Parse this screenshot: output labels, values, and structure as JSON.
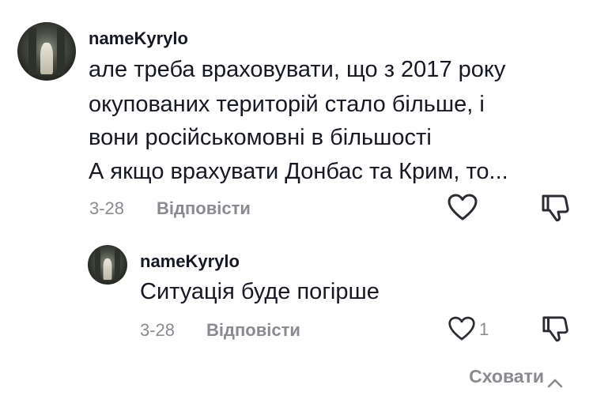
{
  "comment": {
    "username": "nameKyrylo",
    "lines": [
      "але треба враховувати, що з 2017 року",
      "окупованих територій стало більше, і",
      "вони російськомовні в більшості",
      "А якщо врахувати Донбас та Крим, то..."
    ],
    "date": "3-28",
    "reply_label": "Відповісти"
  },
  "reply": {
    "username": "nameKyrylo",
    "text": "Ситуація буде погірше",
    "date": "3-28",
    "reply_label": "Відповісти",
    "like_count": "1"
  },
  "hide_label": "Сховати",
  "icons": {
    "like": "heart-outline-icon",
    "dislike": "thumbs-down-outline-icon",
    "collapse": "chevron-up-icon"
  },
  "colors": {
    "text": "#161823",
    "muted": "#8a8b91",
    "background": "#ffffff"
  }
}
